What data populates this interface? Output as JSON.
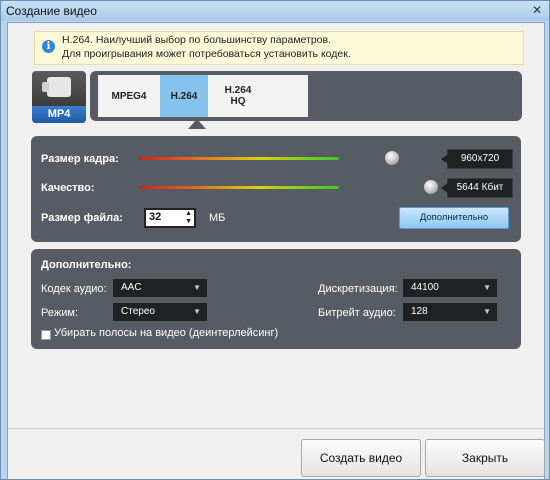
{
  "window": {
    "title": "Создание видео",
    "close_glyph": "✕"
  },
  "info": {
    "icon": "info-icon",
    "glyph": "i",
    "text": "H.264. Наилучший выбор по большинству параметров.\nДля проигрывания может потребоваться установить кодек."
  },
  "format": {
    "icon": "camcorder-icon",
    "label": "MP4"
  },
  "codecs": {
    "tabs": [
      "MPEG4",
      "H.264",
      "H.264\nHQ"
    ],
    "selected_index": 1
  },
  "quality": {
    "frame_size_label": "Размер кадра:",
    "frame_size_value": "960x720",
    "quality_label": "Качество:",
    "quality_value": "5644 Кбит",
    "file_size_label": "Размер файла:",
    "file_size_value": "32",
    "file_size_unit": "МБ",
    "advanced_button": "Дополнительно"
  },
  "advanced": {
    "heading": "Дополнительно:",
    "audio_codec_label": "Кодек аудио:",
    "audio_codec_value": "AAC",
    "mode_label": "Режим:",
    "mode_value": "Стерео",
    "sample_rate_label": "Дискретизация:",
    "sample_rate_value": "44100",
    "audio_bitrate_label": "Битрейт аудио:",
    "audio_bitrate_value": "128",
    "deinterlace_label": "Убирать полосы на видео (деинтерлейсинг)",
    "deinterlace_checked": false,
    "dropdown_arrow": "▼"
  },
  "footer": {
    "create_button": "Создать видео",
    "close_button": "Закрыть"
  }
}
